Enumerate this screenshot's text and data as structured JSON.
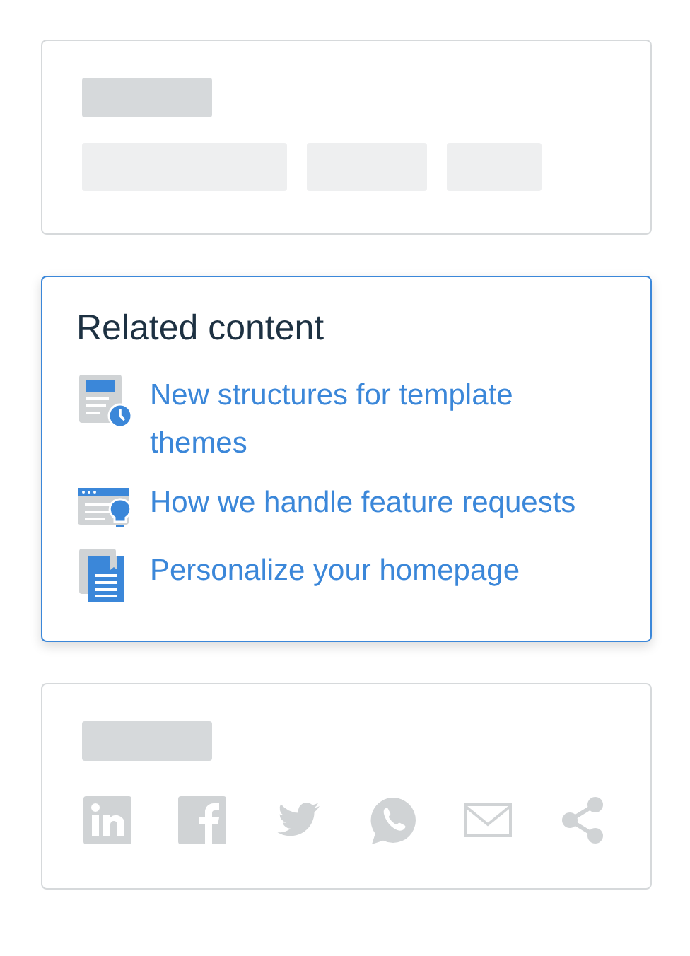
{
  "related_content": {
    "title": "Related content",
    "links": [
      {
        "kind": "article",
        "label": "New structures for template themes"
      },
      {
        "kind": "idea",
        "label": "How we handle feature requests"
      },
      {
        "kind": "guide",
        "label": "Personalize your homepage"
      }
    ]
  }
}
